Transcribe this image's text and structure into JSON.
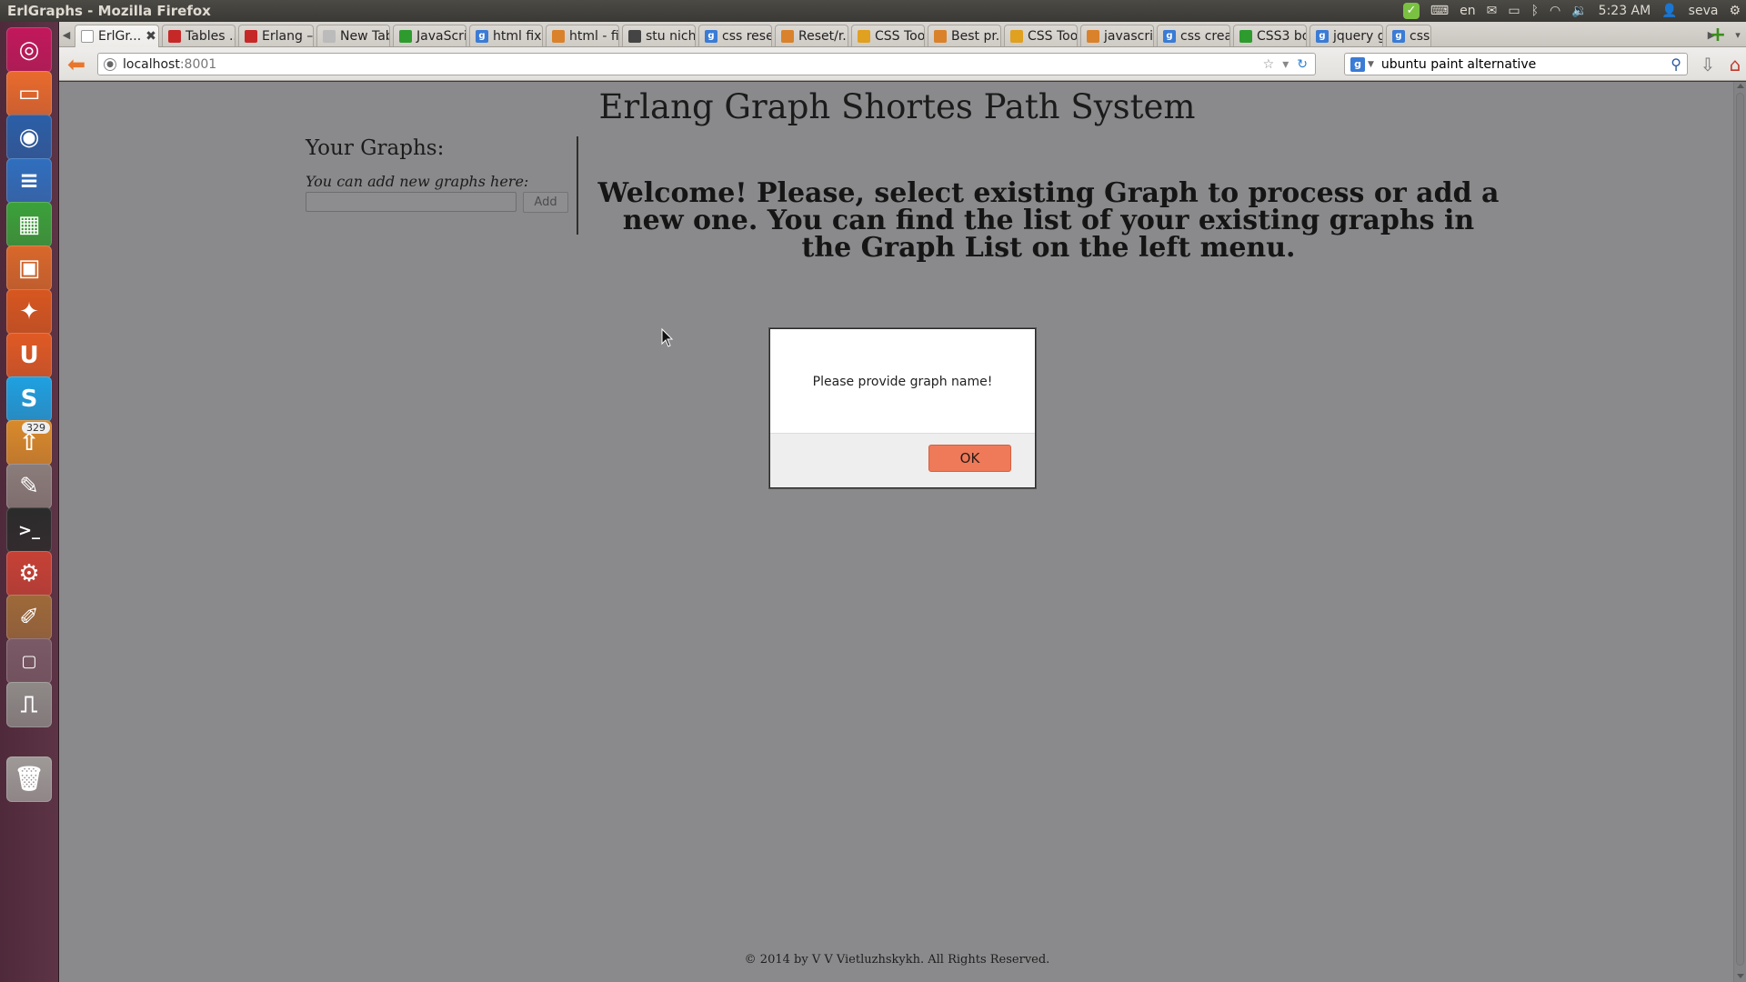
{
  "window": {
    "title": "ErlGraphs - Mozilla Firefox"
  },
  "tray": {
    "keyboard_layout": "en",
    "time": "5:23 AM",
    "user": "seva"
  },
  "launcher": {
    "items": [
      {
        "name": "dash-home",
        "color": "#c2185b"
      },
      {
        "name": "files",
        "color": "#e96b2d"
      },
      {
        "name": "firefox",
        "color": "#2a5fa8"
      },
      {
        "name": "writer",
        "color": "#2f6fbf"
      },
      {
        "name": "calc",
        "color": "#3aa23a"
      },
      {
        "name": "impress",
        "color": "#d9682a"
      },
      {
        "name": "software-center",
        "color": "#d8571f"
      },
      {
        "name": "ubuntu-one",
        "color": "#e05a24"
      },
      {
        "name": "skype",
        "color": "#1ea1e1"
      },
      {
        "name": "updates",
        "color": "#d98a2a",
        "badge": "329"
      },
      {
        "name": "text-editor",
        "color": "#8a7d7a"
      },
      {
        "name": "terminal",
        "color": "#2b2b2b"
      },
      {
        "name": "settings",
        "color": "#c74135"
      },
      {
        "name": "drawing",
        "color": "#9e6a3a"
      },
      {
        "name": "workspace",
        "color": "#7a5a66"
      },
      {
        "name": "usb",
        "color": "#8e8a88"
      },
      {
        "name": "trash",
        "color": "#9e9a98"
      }
    ]
  },
  "tabs": [
    {
      "label": "ErlGr...",
      "fav": "#ffffff",
      "fav_text": "",
      "active": true
    },
    {
      "label": "Tables ...",
      "fav": "#c62828",
      "fav_text": ""
    },
    {
      "label": "Erlang –...",
      "fav": "#c62828",
      "fav_text": ""
    },
    {
      "label": "New Tab",
      "fav": "#bbbbbb",
      "fav_text": ""
    },
    {
      "label": "JavaScri...",
      "fav": "#2e9b2e",
      "fav_text": ""
    },
    {
      "label": "html fix...",
      "fav": "#3a7bd5",
      "fav_text": "g"
    },
    {
      "label": "html - fi...",
      "fav": "#d9822b",
      "fav_text": ""
    },
    {
      "label": "stu nich...",
      "fav": "#444444",
      "fav_text": ""
    },
    {
      "label": "css rese...",
      "fav": "#3a7bd5",
      "fav_text": "g"
    },
    {
      "label": "Reset/r...",
      "fav": "#d9822b",
      "fav_text": ""
    },
    {
      "label": "CSS Too...",
      "fav": "#e0a020",
      "fav_text": ""
    },
    {
      "label": "Best pr...",
      "fav": "#d9822b",
      "fav_text": ""
    },
    {
      "label": "CSS Too...",
      "fav": "#e0a020",
      "fav_text": ""
    },
    {
      "label": "javascri...",
      "fav": "#d9822b",
      "fav_text": ""
    },
    {
      "label": "css crea...",
      "fav": "#3a7bd5",
      "fav_text": "g"
    },
    {
      "label": "CSS3 bo...",
      "fav": "#2e9b2e",
      "fav_text": ""
    },
    {
      "label": "jquery g...",
      "fav": "#3a7bd5",
      "fav_text": "g"
    },
    {
      "label": "css i",
      "fav": "#3a7bd5",
      "fav_text": "g"
    }
  ],
  "urlbar": {
    "host": "localhost",
    "port": ":8001"
  },
  "search": {
    "value": "ubuntu paint alternative"
  },
  "page": {
    "title": "Erlang Graph Shortes Path System",
    "sidebar_heading": "Your Graphs:",
    "add_hint": "You can add new graphs here:",
    "add_button": "Add",
    "add_input_value": "",
    "welcome": "Welcome! Please, select existing Graph to process or add a new one. You can find the list of your existing graphs in the Graph List on the left menu.",
    "footer": "© 2014 by V V Vietluzhskykh. All Rights Reserved."
  },
  "modal": {
    "message": "Please provide graph name!",
    "ok_label": "OK"
  }
}
